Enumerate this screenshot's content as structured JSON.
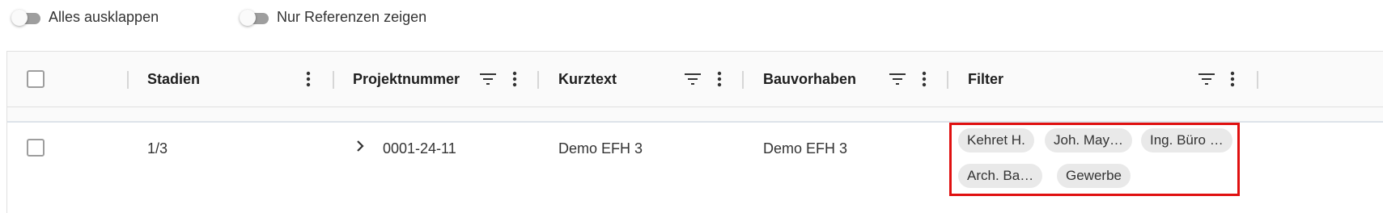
{
  "toggles": {
    "expand_all": "Alles ausklappen",
    "only_references": "Nur Referenzen zeigen"
  },
  "columns": {
    "stadien": "Stadien",
    "projektnummer": "Projektnummer",
    "kurztext": "Kurztext",
    "bauvorhaben": "Bauvorhaben",
    "filter": "Filter"
  },
  "rows": [
    {
      "stadien": "1/3",
      "projektnummer": "0001-24-11",
      "kurztext": "Demo EFH 3",
      "bauvorhaben": "Demo EFH 3",
      "filter_chips": [
        "Kehret H.",
        "Joh. May…",
        "Ing. Büro …",
        "Arch. Ba…",
        "Gewerbe"
      ]
    }
  ],
  "icons": {
    "filter": "filter-lines-icon",
    "menu": "more-vertical-icon",
    "expand": "chevron-right-icon"
  }
}
